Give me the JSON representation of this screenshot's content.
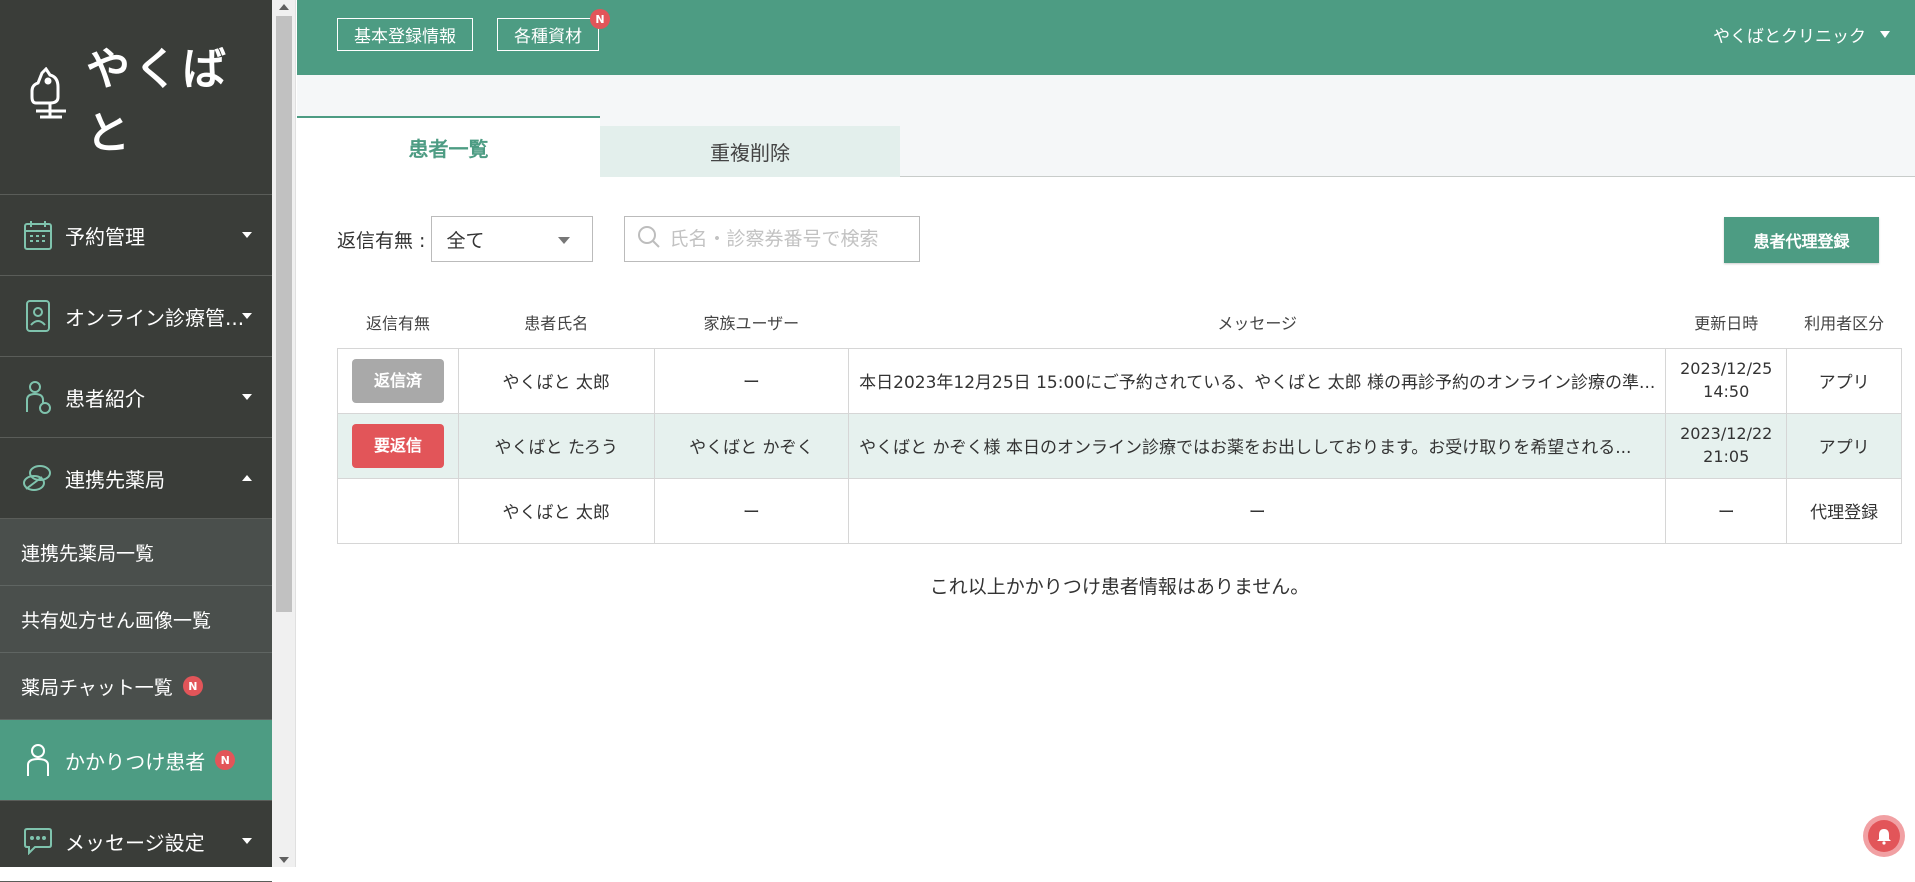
{
  "brand": {
    "name": "やくばと"
  },
  "sidebar": {
    "items": [
      {
        "label": "予約管理",
        "icon": "calendar-icon"
      },
      {
        "label": "オンライン診療管...",
        "icon": "phone-doctor-icon"
      },
      {
        "label": "患者紹介",
        "icon": "patient-referral-icon"
      },
      {
        "label": "連携先薬局",
        "icon": "pills-icon"
      }
    ],
    "sub_items": [
      {
        "label": "連携先薬局一覧"
      },
      {
        "label": "共有処方せん画像一覧"
      },
      {
        "label": "薬局チャット一覧",
        "badge": "N"
      }
    ],
    "active_item": {
      "label": "かかりつけ患者",
      "badge": "N",
      "icon": "person-icon"
    },
    "bottom_item": {
      "label": "メッセージ設定",
      "icon": "chat-icon"
    }
  },
  "header": {
    "btn_basic_info": "基本登録情報",
    "btn_materials": "各種資材",
    "materials_badge": "N",
    "clinic_name": "やくばとクリニック"
  },
  "tabs": {
    "active": "患者一覧",
    "inactive": "重複削除"
  },
  "filter": {
    "label": "返信有無 :",
    "selected": "全て",
    "search_placeholder": "氏名・診察券番号で検索"
  },
  "proxy_button": "患者代理登録",
  "table": {
    "headers": [
      "返信有無",
      "患者氏名",
      "家族ユーザー",
      "メッセージ",
      "更新日時",
      "利用者区分"
    ],
    "rows": [
      {
        "status": "返信済",
        "name": "やくばと 太郎",
        "family": "ー",
        "message": "本日2023年12月25日 15:00にご予約されている、やくばと 太郎 様の再診予約のオンライン診療の準...",
        "date": "2023/12/25",
        "time": "14:50",
        "type": "アプリ"
      },
      {
        "status": "要返信",
        "name": "やくばと たろう",
        "family": "やくばと かぞく",
        "message": "やくばと かぞく様 本日のオンライン診療ではお薬をお出ししております。お受け取りを希望される...",
        "date": "2023/12/22",
        "time": "21:05",
        "type": "アプリ"
      },
      {
        "status": "",
        "name": "やくばと 太郎",
        "family": "ー",
        "message": "ー",
        "date": "ー",
        "time": "",
        "type": "代理登録"
      }
    ]
  },
  "no_more_text": "これ以上かかりつけ患者情報はありません。",
  "colors": {
    "primary": "#4d9c83",
    "sidebar": "#3a3d39",
    "danger": "#e25559"
  }
}
